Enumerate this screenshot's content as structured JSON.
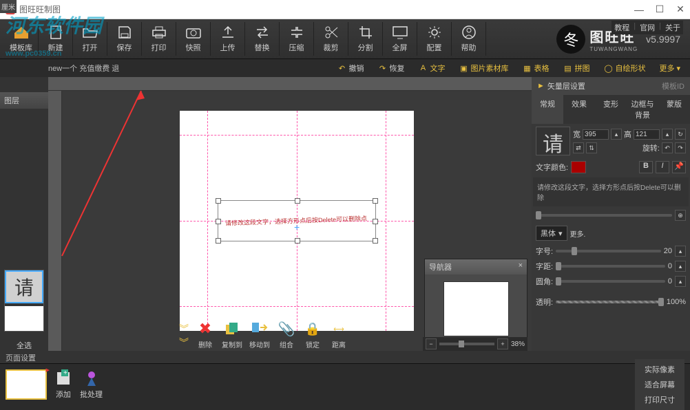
{
  "title": "图旺旺制图",
  "watermark": {
    "main": "河东软件园",
    "sub": "www.pc0359.cn"
  },
  "topLinks": {
    "tutorial": "教程",
    "official": "官网",
    "about": "关于"
  },
  "toolbar": {
    "templateLib": "模板库",
    "items": [
      "新建",
      "打开",
      "保存",
      "打印",
      "快照",
      "上传",
      "替换",
      "压缩",
      "裁剪",
      "分割",
      "全屏",
      "配置",
      "帮助"
    ]
  },
  "brand": {
    "main": "图旺旺",
    "sub": "TUWANGWANG",
    "version": "v5.9997"
  },
  "secBar": {
    "left": "new一个  充值缴费 退",
    "undo": "撤销",
    "redo": "恢复",
    "text": "文字",
    "imgLib": "图片素材库",
    "table": "表格",
    "puzzle": "拼图",
    "shapes": "自绘形状",
    "more": "更多"
  },
  "rulerUnit": "厘米",
  "leftPanel": {
    "layers": "图层",
    "thumbChar": "请",
    "selectAll": "全选"
  },
  "pageSettings": "页面设置",
  "canvas": {
    "curveText": "请修改这段文字，选择方形点后按Delete可以删除点"
  },
  "navigator": {
    "title": "导航器"
  },
  "zoom": {
    "value": "38%"
  },
  "bottomTools": [
    "删除",
    "复制到",
    "移动到",
    "组合",
    "锁定",
    "距离"
  ],
  "rightPanel": {
    "vecHeader": "矢量层设置",
    "templateId": "模板ID",
    "tabs": [
      "常规",
      "效果",
      "变形",
      "边框与背景",
      "蒙版"
    ],
    "bigChar": "请",
    "widthLabel": "宽",
    "widthVal": "395",
    "heightLabel": "高",
    "heightVal": "121",
    "rotateLabel": "旋转:",
    "textColor": "文字颜色:",
    "hint": "请修改这段文字，选择方形点后按Delete可以删除",
    "font": "黑体",
    "moreFonts": "更多.",
    "fontSize": "字号:",
    "fontSizeVal": "20",
    "spacing": "字距:",
    "spacingVal": "0",
    "radius": "圆角:",
    "radiusVal": "0",
    "opacity": "透明:",
    "opacityVal": "100%"
  },
  "bottomStrip": {
    "add": "添加",
    "batch": "批处理"
  },
  "bottomMenu": [
    "实际像素",
    "适合屏幕",
    "打印尺寸"
  ]
}
